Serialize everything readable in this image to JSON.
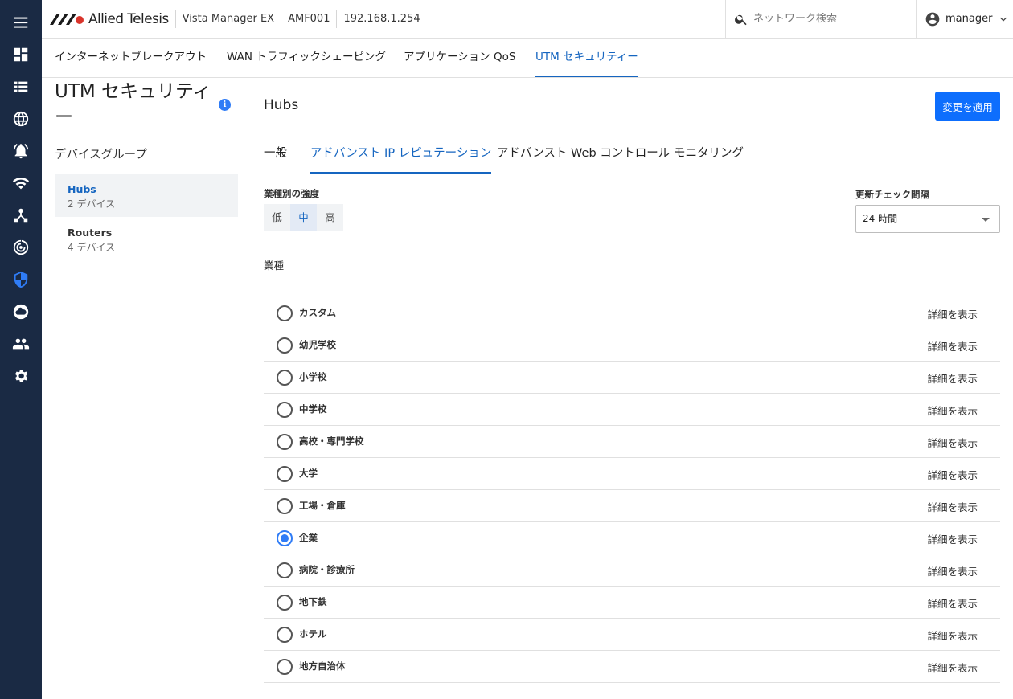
{
  "rail": {
    "items": [
      {
        "icon": "menu-icon"
      },
      {
        "icon": "dashboard-icon"
      },
      {
        "icon": "list-icon"
      },
      {
        "icon": "globe-icon"
      },
      {
        "icon": "alert-bell-icon"
      },
      {
        "icon": "wifi-icon"
      },
      {
        "icon": "network-topology-icon"
      },
      {
        "icon": "radar-icon"
      },
      {
        "icon": "security-shield-icon"
      },
      {
        "icon": "cloud-icon"
      },
      {
        "icon": "users-icon"
      },
      {
        "icon": "settings-gear-icon"
      }
    ],
    "active_color": "#2f7cf6",
    "background": "#1a2a44"
  },
  "header": {
    "brand": "Allied Telesis",
    "product": "Vista Manager EX",
    "device": "AMF001",
    "ip": "192.168.1.254",
    "search_placeholder": "ネットワーク検索",
    "user": "manager"
  },
  "top_tabs": [
    {
      "label": "インターネットブレークアウト"
    },
    {
      "label": "WAN トラフィックシェーピング"
    },
    {
      "label": "アプリケーション QoS"
    },
    {
      "label": "UTM セキュリティー",
      "active": true
    }
  ],
  "sidebar": {
    "title": "UTM セキュリティー",
    "group_label": "デバイスグループ",
    "groups": [
      {
        "name": "Hubs",
        "count": "2 デバイス",
        "selected": true
      },
      {
        "name": "Routers",
        "count": "4 デバイス"
      }
    ]
  },
  "main": {
    "title": "Hubs",
    "apply_label": "変更を適用",
    "tabs": [
      {
        "label": "一般"
      },
      {
        "label": "アドバンスト IP レピュテーション",
        "active": true
      },
      {
        "label": "アドバンスト Web コントロール"
      },
      {
        "label": "モニタリング"
      }
    ],
    "strength_label": "業種別の強度",
    "strength_options": [
      "低",
      "中",
      "高"
    ],
    "strength_selected": "中",
    "interval_label": "更新チェック間隔",
    "interval_value": "24 時間",
    "industry_label": "業種",
    "detail_label": "詳細を表示",
    "industries": [
      {
        "label": "カスタム"
      },
      {
        "label": "幼児学校"
      },
      {
        "label": "小学校"
      },
      {
        "label": "中学校"
      },
      {
        "label": "高校・専門学校"
      },
      {
        "label": "大学"
      },
      {
        "label": "工場・倉庫"
      },
      {
        "label": "企業",
        "selected": true
      },
      {
        "label": "病院・診療所"
      },
      {
        "label": "地下鉄"
      },
      {
        "label": "ホテル"
      },
      {
        "label": "地方自治体"
      }
    ]
  },
  "colors": {
    "accent": "#1565c0",
    "button": "#0d6efd"
  }
}
